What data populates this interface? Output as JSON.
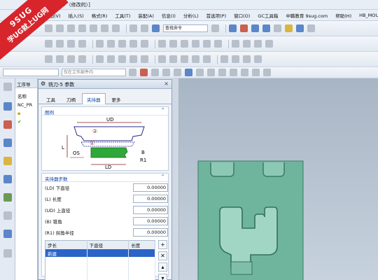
{
  "window": {
    "title": "...7-4.prt （修改的）]"
  },
  "watermark": {
    "line1": "9SUG",
    "line2": "学UG就上UG网"
  },
  "menu": [
    "视图(V)",
    "插入(S)",
    "格式(R)",
    "工具(T)",
    "装配(A)",
    "信息(I)",
    "分析(L)",
    "首选项(P)",
    "窗口(O)",
    "GC工具箱",
    "中職教育 9sug.com",
    "帮助(H)",
    "HB_MOULD"
  ],
  "toolbar": {
    "search_placeholder": "查找命令",
    "filter_value": "仅在工作部件内"
  },
  "navigator": {
    "title": "工序导",
    "column": "名称",
    "root": "NC_PR"
  },
  "dialog": {
    "title": "铣刀-5 参数",
    "tabs": [
      "工具",
      "刀柄",
      "夹持器",
      "更多"
    ],
    "selected_tab": "夹持器",
    "illustration_header": "图例",
    "diagram_labels": {
      "ud": "UD",
      "ld": "LD",
      "l": "L",
      "os": "OS",
      "b": "B",
      "r1": "R1",
      "n1": "①",
      "n2": "②"
    },
    "steps_header": "夹持器步数",
    "params": [
      {
        "label": "(LD) 下直径",
        "value": "0.00000"
      },
      {
        "label": "(L) 长度",
        "value": "0.00000"
      },
      {
        "label": "(UD) 上直径",
        "value": "0.00000"
      },
      {
        "label": "(B) 锥角",
        "value": "0.00000"
      },
      {
        "label": "(R1) 拐角半径",
        "value": "0.00000"
      }
    ],
    "table": {
      "columns": [
        "步长",
        "下直径",
        "长度"
      ],
      "rows": [
        [
          "新建",
          "",
          ""
        ]
      ]
    }
  },
  "colors": {
    "part": "#6fb59e",
    "selection": "#2b64c7",
    "watermark": "#d8242b"
  }
}
